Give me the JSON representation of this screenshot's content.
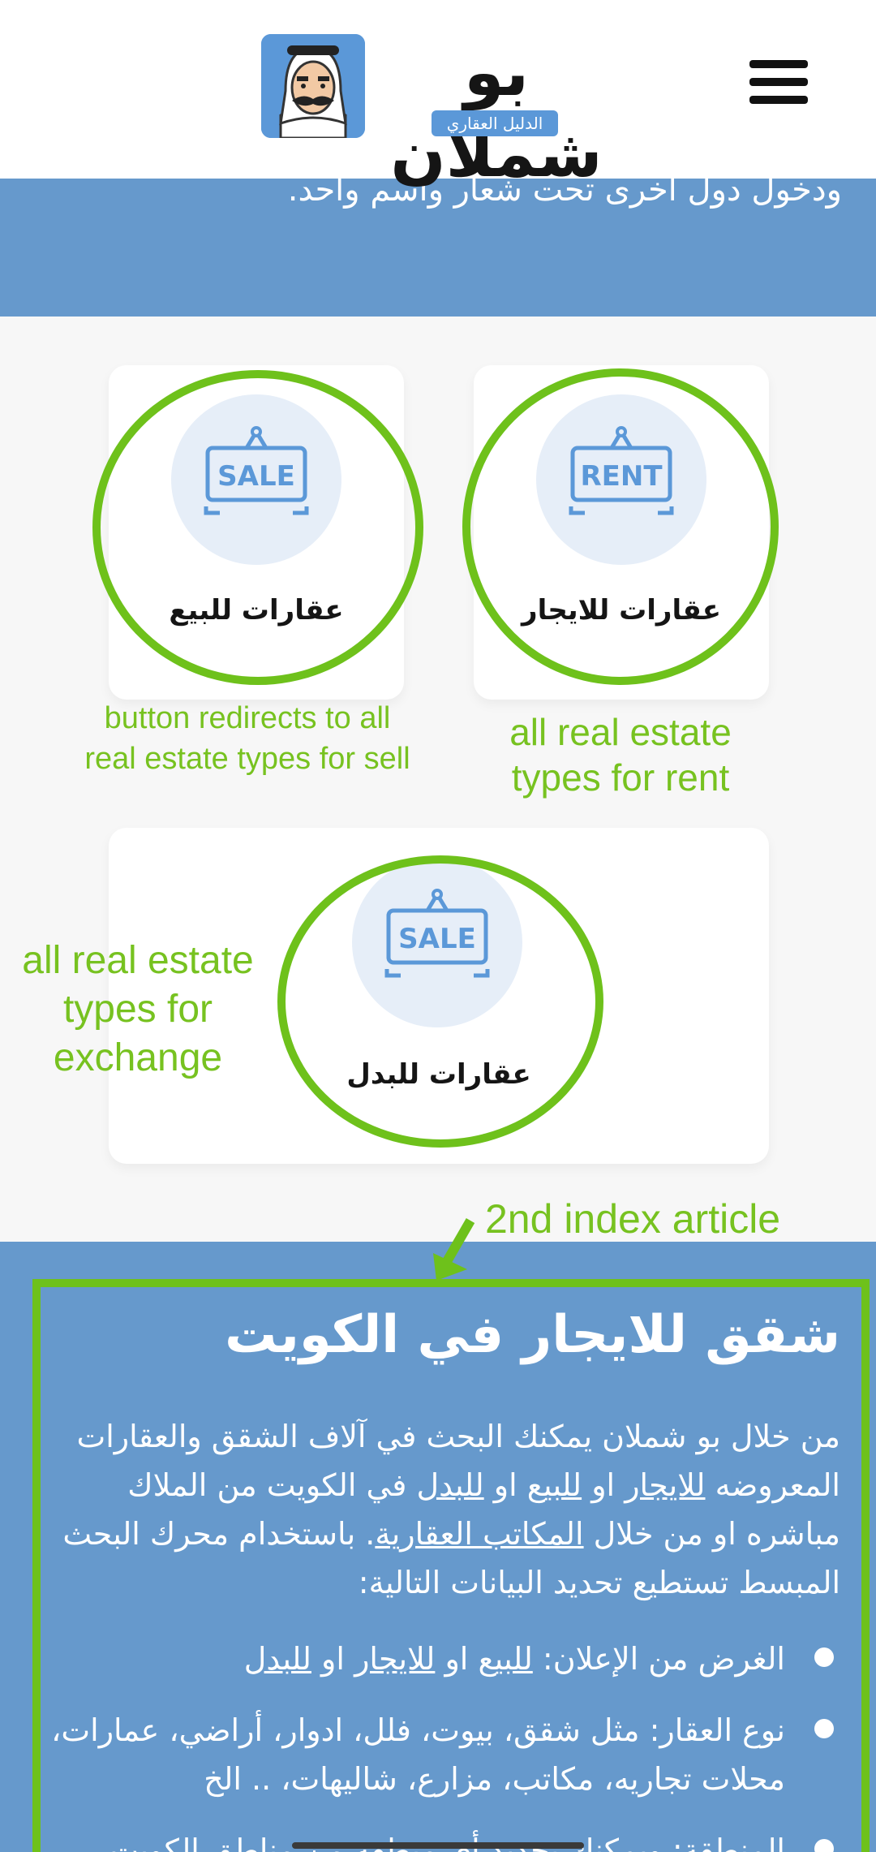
{
  "header": {
    "title": "بو شملان",
    "subtitle": "الدليل العقاري",
    "logo_icon": "kuwaiti-man-avatar-icon",
    "menu_icon": "hamburger-menu-icon"
  },
  "intro": {
    "text_tail": "ودخول دول أخرى تحت شعار واسم واحد."
  },
  "categories": [
    {
      "label": "عقارات للبيع",
      "badge": "SALE",
      "icon": "sale-sign-icon",
      "annotation": "button redirects to all real estate types for sell"
    },
    {
      "label": "عقارات للايجار",
      "badge": "RENT",
      "icon": "rent-sign-icon",
      "annotation": "all real estate types for rent"
    },
    {
      "label": "عقارات للبدل",
      "badge": "SALE",
      "icon": "sale-sign-icon",
      "annotation": "all real estate types for exchange"
    }
  ],
  "article": {
    "annotation": "2nd index article",
    "title": "شقق للايجار في الكويت",
    "p1_part1": "من خلال بو شملان يمكنك البحث في آلاف الشقق والعقارات المعروضه",
    "link_rent": "للايجار",
    "word_or": "او",
    "link_sale": "للبيع",
    "link_exchange": "للبدل",
    "p1_part2": "في الكويت من الملاك مباشره او من خلال",
    "link_offices": "المكاتب العقارية",
    "p1_part3": ". باستخدام محرك البحث المبسط تستطيع تحديد البيانات التالية:",
    "bullet1_prefix": "الغرض من الإعلان:",
    "bullet2": "نوع العقار: مثل شقق، بيوت، فلل، ادوار، أراضي، عمارات، محلات تجاريه، مكاتب، مزارع، شاليهات، .. الخ",
    "bullet3": "المنطقة: ويمكنك تحديد أي منطقة من مناطق الكويت"
  },
  "colors": {
    "brand_blue": "#6699cc",
    "annotation_green": "#6ec11b"
  }
}
